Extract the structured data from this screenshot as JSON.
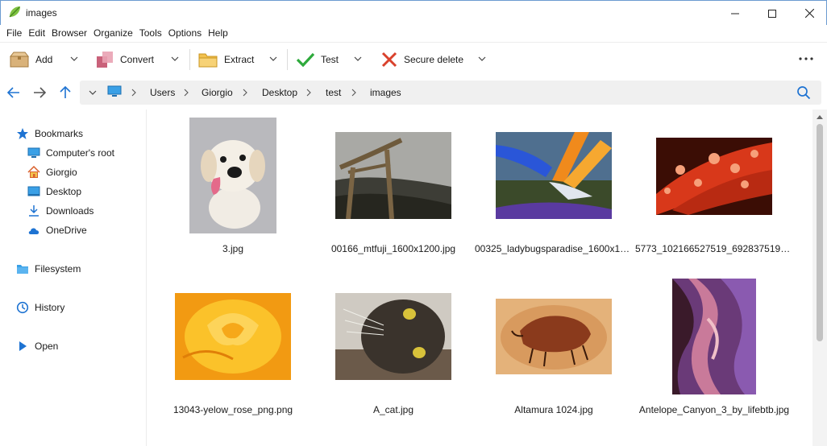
{
  "window": {
    "title": "images"
  },
  "menu": [
    "File",
    "Edit",
    "Browser",
    "Organize",
    "Tools",
    "Options",
    "Help"
  ],
  "toolbar": {
    "add_label": "Add",
    "convert_label": "Convert",
    "extract_label": "Extract",
    "test_label": "Test",
    "secure_delete_label": "Secure delete"
  },
  "breadcrumb": [
    "Users",
    "Giorgio",
    "Desktop",
    "test",
    "images"
  ],
  "sidebar": {
    "bookmarks": "Bookmarks",
    "items": [
      "Computer's root",
      "Giorgio",
      "Desktop",
      "Downloads",
      "OneDrive"
    ],
    "filesystem": "Filesystem",
    "history": "History",
    "open": "Open"
  },
  "files": [
    {
      "name": "3.jpg",
      "icon": "puppy-thumbnail"
    },
    {
      "name": "00166_mtfuji_1600x1200.jpg",
      "icon": "torii-thumbnail"
    },
    {
      "name": "00325_ladybugsparadise_1600x120...",
      "icon": "bird-of-paradise-thumbnail"
    },
    {
      "name": "5773_102166527519_692837519_204...",
      "icon": "red-leaf-drops-thumbnail"
    },
    {
      "name": "13043-yelow_rose_png.png",
      "icon": "yellow-rose-thumbnail"
    },
    {
      "name": "A_cat.jpg",
      "icon": "cat-thumbnail"
    },
    {
      "name": "Altamura 1024.jpg",
      "icon": "cave-painting-thumbnail"
    },
    {
      "name": "Antelope_Canyon_3_by_lifebtb.jpg",
      "icon": "canyon-thumbnail"
    }
  ],
  "colors": {
    "accent": "#1e73d2",
    "test_green": "#2eaa3c",
    "delete_red": "#d9412c",
    "folder_yellow": "#f2c14e"
  }
}
